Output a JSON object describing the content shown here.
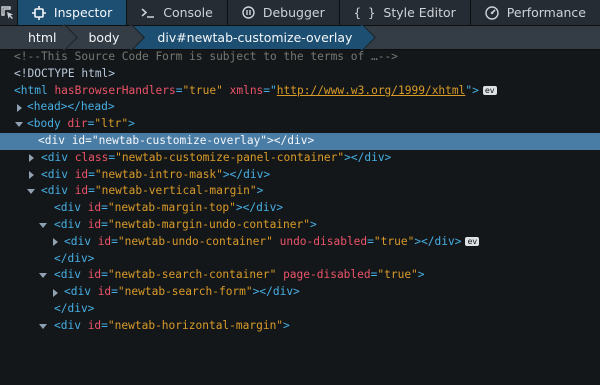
{
  "toolbar": {
    "pick_icon": "element-picker-icon",
    "tabs": [
      {
        "label": "Inspector",
        "icon": "inspector-icon",
        "selected": true
      },
      {
        "label": "Console",
        "icon": "console-icon",
        "selected": false
      },
      {
        "label": "Debugger",
        "icon": "debugger-icon",
        "selected": false
      },
      {
        "label": "Style Editor",
        "icon": "style-editor-icon",
        "selected": false
      },
      {
        "label": "Performance",
        "icon": "performance-icon",
        "selected": false
      }
    ]
  },
  "breadcrumbs": [
    {
      "label": "html",
      "selected": false
    },
    {
      "label": "body",
      "selected": false
    },
    {
      "label": "div#newtab-customize-overlay",
      "selected": true
    }
  ],
  "markup": {
    "comment": "<!--This Source Code Form is subject to the terms of …-->",
    "doctype": "<!DOCTYPE html>",
    "html_open": "<html",
    "html_attr1": "hasBrowserHandlers",
    "html_val1": "\"true\"",
    "html_attr2": "xmlns",
    "html_val2": "http://www.w3.org/1999/xhtml",
    "event_badge": "ev",
    "head": "<head></head>",
    "body_open": "<body",
    "body_attr": "dir",
    "body_val": "\"ltr\"",
    "l_overlay_id": "\"newtab-customize-overlay\"",
    "l_panel_class": "\"newtab-customize-panel-container\"",
    "l_intro_id": "\"newtab-intro-mask\"",
    "l_vertical_id": "\"newtab-vertical-margin\"",
    "l_margin_top_id": "\"newtab-margin-top\"",
    "l_undo_container_id": "\"newtab-margin-undo-container\"",
    "l_undo_id": "\"newtab-undo-container\"",
    "l_undo_attr": "undo-disabled",
    "l_undo_val": "\"true\"",
    "l_search_container_id": "\"newtab-search-container\"",
    "l_search_attr": "page-disabled",
    "l_search_val": "\"true\"",
    "l_search_form_id": "\"newtab-search-form\"",
    "l_horizontal_id": "\"newtab-horizontal-margin\""
  },
  "colors": {
    "background": "#14171a",
    "toolbar": "#252c33",
    "selected_tab": "#1d4f73",
    "selected_row": "#4a7da6",
    "tag": "#46afe3",
    "attribute": "#eb5368",
    "value": "#d99b28",
    "comment": "#757873"
  }
}
